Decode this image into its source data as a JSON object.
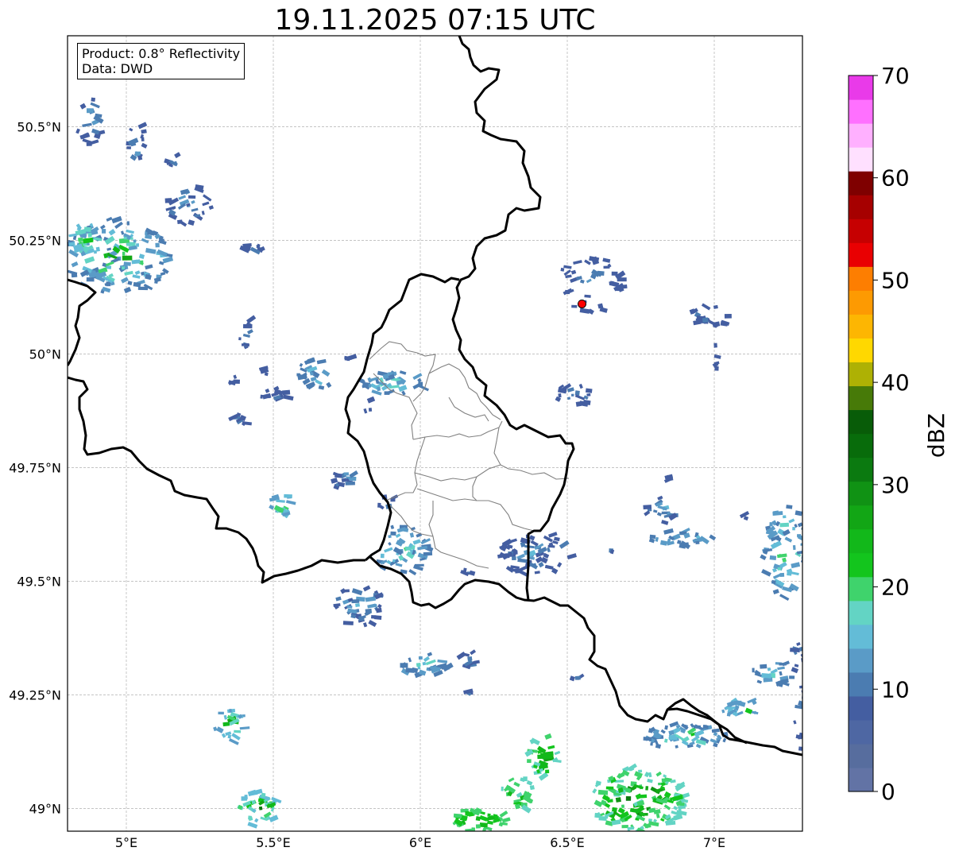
{
  "title": "19.11.2025 07:15 UTC",
  "info": {
    "product": "Product: 0.8° Reflectivity",
    "data": "Data: DWD"
  },
  "map": {
    "lon_range": [
      4.8,
      7.3
    ],
    "lat_range": [
      48.95,
      50.7
    ],
    "lon_ticks": [
      {
        "value": 5.0,
        "label": "5°E"
      },
      {
        "value": 5.5,
        "label": "5.5°E"
      },
      {
        "value": 6.0,
        "label": "6°E"
      },
      {
        "value": 6.5,
        "label": "6.5°E"
      },
      {
        "value": 7.0,
        "label": "7°E"
      }
    ],
    "lat_ticks": [
      {
        "value": 50.5,
        "label": "50.5°N"
      },
      {
        "value": 50.25,
        "label": "50.25°N"
      },
      {
        "value": 50.0,
        "label": "50°N"
      },
      {
        "value": 49.75,
        "label": "49.75°N"
      },
      {
        "value": 49.5,
        "label": "49.5°N"
      },
      {
        "value": 49.25,
        "label": "49.25°N"
      },
      {
        "value": 49.0,
        "label": "49°N"
      }
    ],
    "radar_site": {
      "lon": 6.55,
      "lat": 50.11,
      "color": "#ff0000"
    },
    "colors": {
      "grid": "#b0b0b0",
      "border": "#000000",
      "district": "#808080"
    }
  },
  "colorbar": {
    "label": "dBZ",
    "min": 0,
    "max": 70,
    "tick_labels": [
      "0",
      "10",
      "20",
      "30",
      "40",
      "50",
      "60",
      "70"
    ],
    "colors": [
      "#6273a5",
      "#576d9e",
      "#4e67a3",
      "#445ea1",
      "#4b7cb1",
      "#5a9bc7",
      "#63bcd7",
      "#63d4c4",
      "#3fd36c",
      "#13c51d",
      "#12b81a",
      "#12a615",
      "#109214",
      "#0b7a10",
      "#086c0b",
      "#085c08",
      "#477a08",
      "#aeb104",
      "#ffd800",
      "#fdb602",
      "#fd9a02",
      "#fd7e01",
      "#e90002",
      "#c60001",
      "#a60000",
      "#7f0000",
      "#ffe0ff",
      "#ffb0ff",
      "#ff70ff",
      "#e93ae9"
    ]
  }
}
